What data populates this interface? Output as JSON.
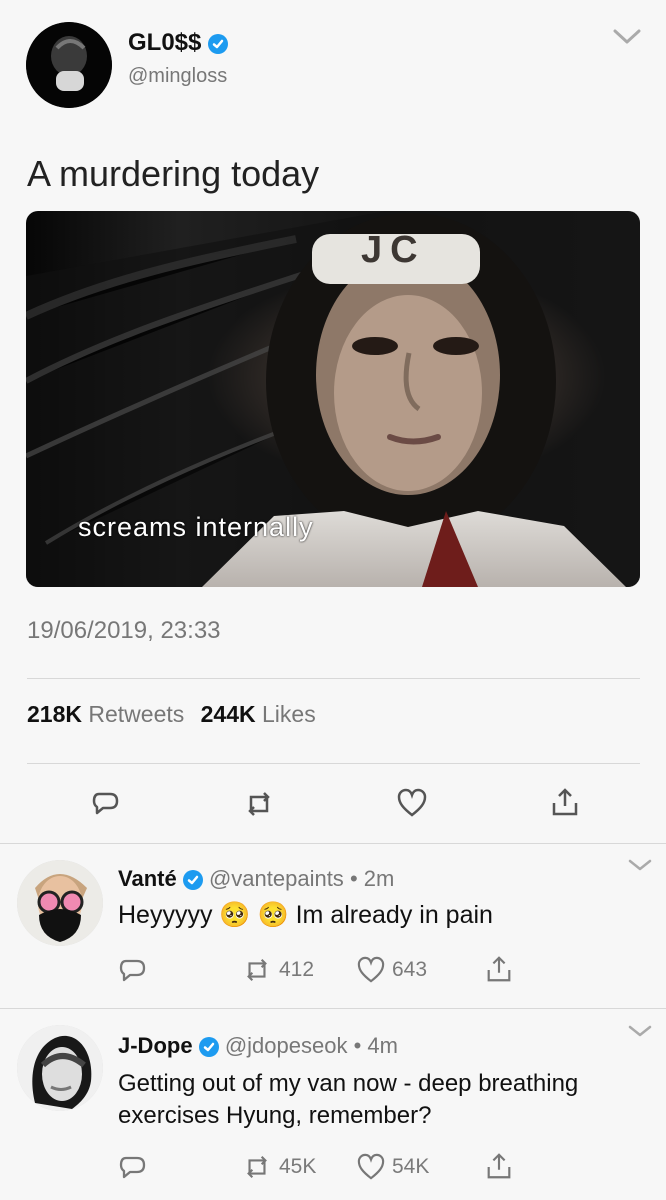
{
  "main_tweet": {
    "name": "GL0$$",
    "handle": "@mingloss",
    "text": "A murdering today",
    "image": {
      "caption": "screams internally",
      "headband_text": "JC"
    },
    "timestamp": "19/06/2019, 23:33",
    "retweets_count": "218K",
    "retweets_label": "Retweets",
    "likes_count": "244K",
    "likes_label": "Likes"
  },
  "replies": [
    {
      "name": "Vanté",
      "handle": "@vantepaints",
      "time": "• 2m",
      "text_part1": "Heyyyyy",
      "emoji1": "🥺",
      "emoji2": "🥺",
      "text_part2": "Im already in pain",
      "retweets": "412",
      "likes": "643"
    },
    {
      "name": "J-Dope",
      "handle": "@jdopeseok",
      "time": "• 4m",
      "text_line1": "Getting out of my van now - deep breathing",
      "text_line2": "exercises Hyung, remember?",
      "retweets": "45K",
      "likes": "54K"
    }
  ],
  "icons": {
    "reply": "reply-icon",
    "retweet": "retweet-icon",
    "like": "heart-icon",
    "share": "share-icon",
    "menu": "chevron-down-icon",
    "verified": "verified-badge-icon"
  },
  "colors": {
    "verified": "#1d9bf0",
    "muted_text": "#777777",
    "background": "#f7f7f7"
  }
}
